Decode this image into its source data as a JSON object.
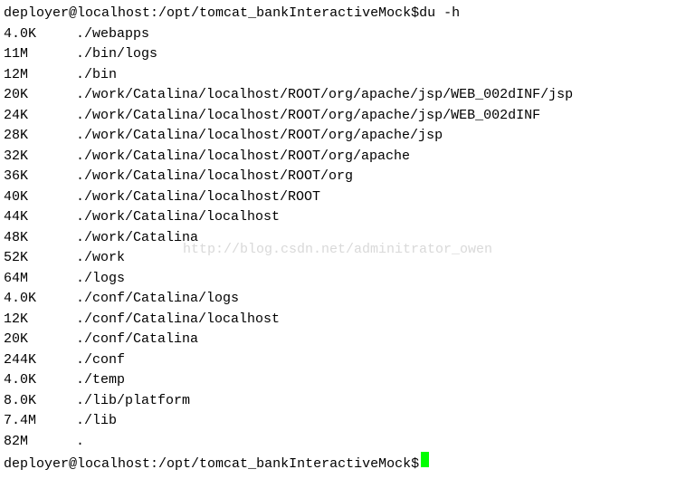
{
  "prompt1": {
    "userhost": "deployer@localhost",
    "separator": ":",
    "path": "/opt/tomcat_bankInteractiveMock",
    "symbol": "$ ",
    "command": "du -h"
  },
  "output": [
    {
      "size": "4.0K",
      "path": "./webapps"
    },
    {
      "size": "11M",
      "path": "./bin/logs"
    },
    {
      "size": "12M",
      "path": "./bin"
    },
    {
      "size": "20K",
      "path": "./work/Catalina/localhost/ROOT/org/apache/jsp/WEB_002dINF/jsp"
    },
    {
      "size": "24K",
      "path": "./work/Catalina/localhost/ROOT/org/apache/jsp/WEB_002dINF"
    },
    {
      "size": "28K",
      "path": "./work/Catalina/localhost/ROOT/org/apache/jsp"
    },
    {
      "size": "32K",
      "path": "./work/Catalina/localhost/ROOT/org/apache"
    },
    {
      "size": "36K",
      "path": "./work/Catalina/localhost/ROOT/org"
    },
    {
      "size": "40K",
      "path": "./work/Catalina/localhost/ROOT"
    },
    {
      "size": "44K",
      "path": "./work/Catalina/localhost"
    },
    {
      "size": "48K",
      "path": "./work/Catalina"
    },
    {
      "size": "52K",
      "path": "./work"
    },
    {
      "size": "64M",
      "path": "./logs"
    },
    {
      "size": "4.0K",
      "path": "./conf/Catalina/logs"
    },
    {
      "size": "12K",
      "path": "./conf/Catalina/localhost"
    },
    {
      "size": "20K",
      "path": "./conf/Catalina"
    },
    {
      "size": "244K",
      "path": "./conf"
    },
    {
      "size": "4.0K",
      "path": "./temp"
    },
    {
      "size": "8.0K",
      "path": "./lib/platform"
    },
    {
      "size": "7.4M",
      "path": "./lib"
    },
    {
      "size": "82M",
      "path": "."
    }
  ],
  "prompt2": {
    "userhost": "deployer@localhost",
    "separator": ":",
    "path": "/opt/tomcat_bankInteractiveMock",
    "symbol": "$ "
  },
  "watermark": "http://blog.csdn.net/adminitrator_owen"
}
